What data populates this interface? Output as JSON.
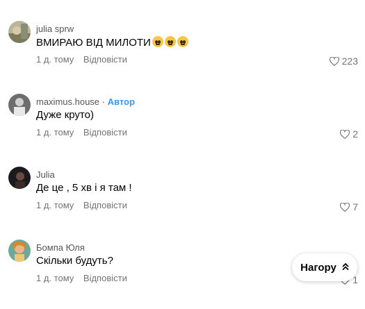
{
  "comments": [
    {
      "username": "julia sprw",
      "text": "ВМИРАЮ ВІД МИЛОТИ",
      "time": "1 д. тому",
      "reply_label": "Відповісти",
      "likes": "223",
      "emoji_count": 3
    },
    {
      "username": "maximus.house",
      "author_sep": "·",
      "author_label": "Автор",
      "text": "Дуже круто)",
      "time": "1 д. тому",
      "reply_label": "Відповісти",
      "likes": "2"
    },
    {
      "username": "Julia",
      "text": "Де це , 5 хв і я там !",
      "time": "1 д. тому",
      "reply_label": "Відповісти",
      "likes": "7"
    },
    {
      "username": "Бомпа Юля",
      "text": "Скільки будуть?",
      "time": "1 д. тому",
      "reply_label": "Відповісти",
      "likes": "1"
    }
  ],
  "scroll_top": {
    "label": "Нагору",
    "icon": "double-chevron-up-icon"
  },
  "colors": {
    "accent": "#3897f0",
    "muted": "#737373"
  }
}
